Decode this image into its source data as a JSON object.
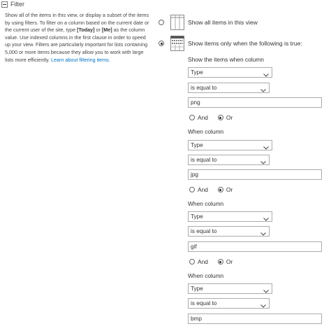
{
  "section": {
    "title": "Filter",
    "description_parts": [
      "Show all of the items in this view, or display a subset of the items by using filters. To filter on a column based on the current date or the current user of the site, type ",
      "[Today]",
      " or ",
      "[Me]",
      " as the column value. Use indexed columns in the first clause in order to speed up your view. Filters are particularly important for lists containing 5,000 or more items because they allow you to work with large lists more efficiently. "
    ],
    "learn_more_link": "Learn about filtering items."
  },
  "options": {
    "show_all_label": "Show all items in this view",
    "show_filtered_label": "Show items only when the following is true:",
    "selected": "filtered"
  },
  "conditions": [
    {
      "heading": "Show the items when column",
      "column": "Type",
      "operator": "is equal to",
      "value": "png",
      "connector_and": "And",
      "connector_or": "Or",
      "connector_selected": "Or"
    },
    {
      "heading": "When column",
      "column": "Type",
      "operator": "is equal to",
      "value": "jpg",
      "connector_and": "And",
      "connector_or": "Or",
      "connector_selected": "Or"
    },
    {
      "heading": "When column",
      "column": "Type",
      "operator": "is equal to",
      "value": "gif",
      "connector_and": "And",
      "connector_or": "Or",
      "connector_selected": "Or"
    },
    {
      "heading": "When column",
      "column": "Type",
      "operator": "is equal to",
      "value": "bmp"
    }
  ],
  "colors": {
    "link": "#0072c6",
    "border": "#ababab"
  }
}
